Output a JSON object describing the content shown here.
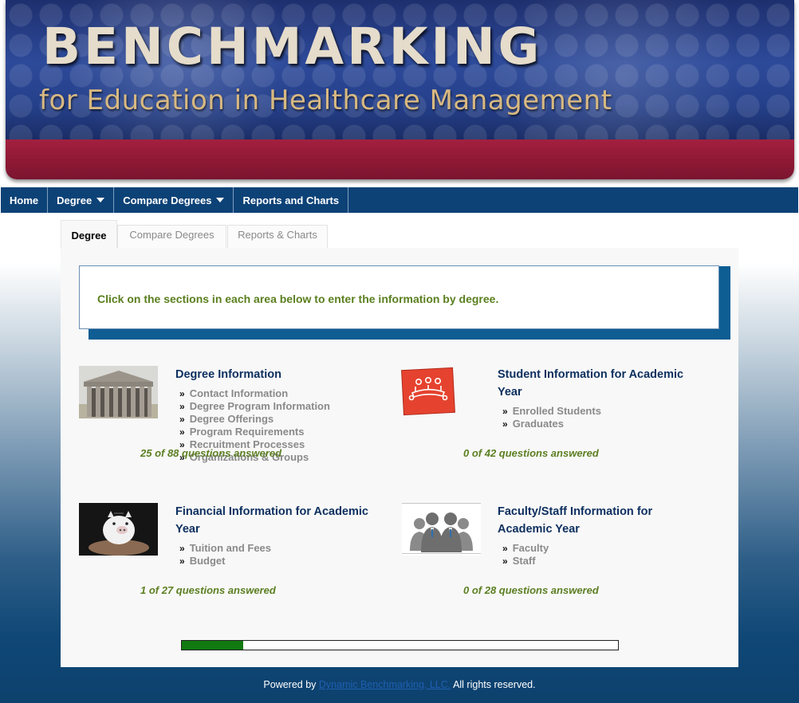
{
  "banner": {
    "title": "BENCHMARKING",
    "subtitle": "for Education in Healthcare Management"
  },
  "nav": {
    "items": [
      {
        "label": "Home",
        "dropdown": false
      },
      {
        "label": "Degree",
        "dropdown": true
      },
      {
        "label": "Compare Degrees",
        "dropdown": true
      },
      {
        "label": "Reports and Charts",
        "dropdown": false
      }
    ]
  },
  "tabs": [
    {
      "label": "Degree",
      "active": true
    },
    {
      "label": "Compare Degrees",
      "active": false
    },
    {
      "label": "Reports & Charts",
      "active": false
    }
  ],
  "instruction": "Click on the sections in each area below to enter the information by degree.",
  "sections": [
    {
      "title": "Degree Information",
      "icon": "building-columns-icon",
      "items": [
        "Contact Information",
        "Degree Program Information",
        "Degree Offerings",
        "Program Requirements",
        "Recruitment Processes",
        "Organizations & Groups"
      ],
      "answered": "25 of 88 questions answered"
    },
    {
      "title": "Student Information for Academic Year",
      "icon": "students-meeting-icon",
      "items": [
        "Enrolled Students",
        "Graduates"
      ],
      "answered": "0 of 42 questions answered"
    },
    {
      "title": "Financial Information for Academic Year",
      "icon": "piggy-bank-icon",
      "items": [
        "Tuition and Fees",
        "Budget"
      ],
      "answered": "1 of 27 questions answered"
    },
    {
      "title": "Faculty/Staff Information for Academic Year",
      "icon": "faculty-people-icon",
      "items": [
        "Faculty",
        "Staff"
      ],
      "answered": "0 of 28 questions answered"
    }
  ],
  "progress": {
    "fraction": 0.14
  },
  "footer": {
    "prefix": "Powered by",
    "link": "Dynamic Benchmarking, LLC.",
    "suffix": "All rights reserved."
  },
  "colors": {
    "nav_bg": "#0d4277",
    "banner_blue": "#2d4a9a",
    "banner_red": "#8c1833",
    "section_title": "#0d2f5f",
    "answered_green": "#5c7f22",
    "progress_green": "#117a11",
    "instruction_green": "#5a7f1e"
  }
}
